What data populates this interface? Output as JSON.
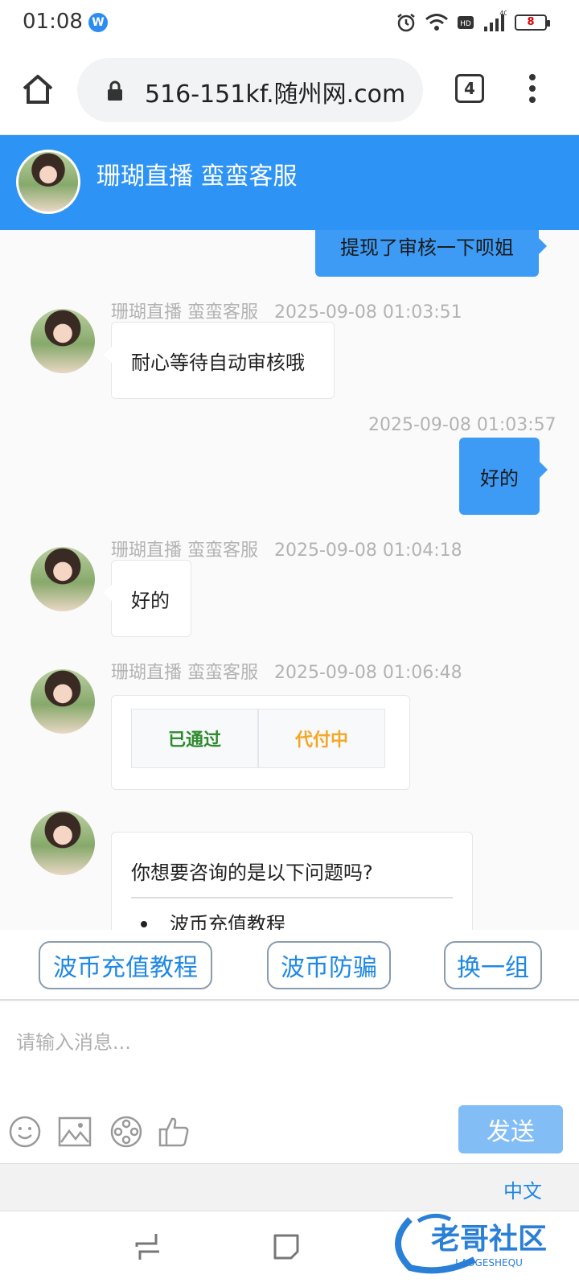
{
  "status_bar": {
    "time": "01:08",
    "network": "4G",
    "battery": "8"
  },
  "browser": {
    "url": "516-151kf.随州网.com",
    "tab_count": "4"
  },
  "chat": {
    "title": "珊瑚直播 蛮蛮客服",
    "messages": [
      {
        "direction": "out",
        "text": "提现了审核一下呗姐"
      },
      {
        "direction": "in",
        "sender": "珊瑚直播 蛮蛮客服",
        "time": "2025-09-08 01:03:51",
        "text": "耐心等待自动审核哦"
      },
      {
        "direction": "out",
        "time": "2025-09-08 01:03:57",
        "text": "好的"
      },
      {
        "direction": "in",
        "sender": "珊瑚直播 蛮蛮客服",
        "time": "2025-09-08 01:04:18",
        "text": "好的"
      },
      {
        "direction": "in",
        "sender": "珊瑚直播 蛮蛮客服",
        "time": "2025-09-08 01:06:48",
        "status_cells": [
          "已通过",
          "代付中"
        ]
      },
      {
        "direction": "in",
        "faq_title": "你想要咨询的是以下问题吗?",
        "faq_items": [
          "波币充值教程"
        ]
      }
    ]
  },
  "quick_replies": [
    "波币充值教程",
    "波币防骗",
    "换一组"
  ],
  "composer": {
    "placeholder": "请输入消息...",
    "send_label": "发送"
  },
  "language": {
    "label": "中文"
  },
  "watermark": {
    "text": "老哥社区",
    "subtext": "LAOGESHEQU"
  },
  "colors": {
    "header": "#2d93f5",
    "outgoing_bubble": "#3d9bf5",
    "send_button": "#82bdf6",
    "approved": "#2e8b2e",
    "pending": "#f5a623"
  },
  "icons": [
    "home-icon",
    "lock-icon",
    "tabs-icon",
    "more-icon",
    "emoji-icon",
    "image-icon",
    "video-icon",
    "thumbs-up-icon",
    "recents-icon",
    "overview-icon",
    "back-icon"
  ]
}
